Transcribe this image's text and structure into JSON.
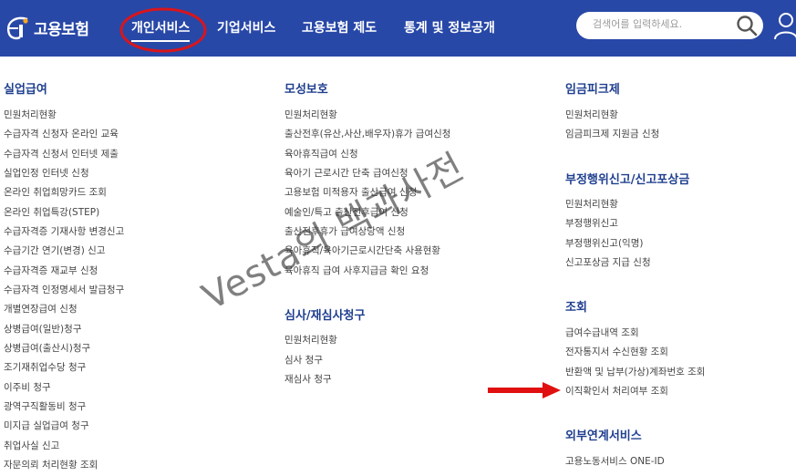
{
  "header": {
    "logo_text": "고용보험",
    "nav": [
      "개인서비스",
      "기업서비스",
      "고용보험 제도",
      "통계 및 정보공개"
    ],
    "search_placeholder": "검색어를 입력하세요.",
    "highlight_color": "#d9151b",
    "bg_color": "#2848a8"
  },
  "columns": [
    {
      "sections": [
        {
          "title": "실업급여",
          "items": [
            "민원처리현황",
            "수급자격 신청자 온라인 교육",
            "수급자격 신청서 인터넷 제출",
            "실업인정 인터넷 신청",
            "온라인 취업희망카드 조회",
            "온라인 취업특강(STEP)",
            "수급자격증 기재사항 변경신고",
            "수급기간 연기(변경) 신고",
            "수급자격증 재교부 신청",
            "수급자격 인정명세서 발급청구",
            "개별연장급여 신청",
            "상병급여(일반)청구",
            "상병급여(출산시)청구",
            "조기재취업수당 청구",
            "이주비 청구",
            "광역구직활동비 청구",
            "미지급 실업급여 청구",
            "취업사실 신고",
            "자문의뢰 처리현황 조회"
          ]
        }
      ]
    },
    {
      "sections": [
        {
          "title": "모성보호",
          "items": [
            "민원처리현황",
            "출산전후(유산,사산,배우자)휴가 급여신청",
            "육아휴직급여 신청",
            "육아기 근로시간 단축 급여신청",
            "고용보험 미적용자 출산급여 신청",
            "예술인/특고 출산전후급여 신청",
            "출산전후휴가 급여상당액 신청",
            "육아휴직/육아기근로시간단축 사용현황",
            "육아휴직 급여 사후지급금 확인 요청"
          ]
        },
        {
          "title": "심사/재심사청구",
          "items": [
            "민원처리현황",
            "심사 청구",
            "재심사 청구"
          ]
        }
      ]
    },
    {
      "sections": [
        {
          "title": "임금피크제",
          "items": [
            "민원처리현황",
            "임금피크제 지원금 신청"
          ]
        },
        {
          "title": "부정행위신고/신고포상금",
          "items": [
            "민원처리현황",
            "부정행위신고",
            "부정행위신고(익명)",
            "신고포상금 지급 신청"
          ]
        },
        {
          "title": "조회",
          "items": [
            "급여수급내역 조회",
            "전자통지서 수신현황 조회",
            "반환액 및 납부(가상)계좌번호 조회",
            "이직확인서 처리여부 조회"
          ]
        },
        {
          "title": "외부연계서비스",
          "items": [
            "고용노동서비스 ONE-ID"
          ]
        }
      ]
    }
  ],
  "watermark": "Vesta의 백과사전",
  "annotations": {
    "arrow_color": "#e01010",
    "arrow_target": "이직확인서 처리여부 조회"
  }
}
